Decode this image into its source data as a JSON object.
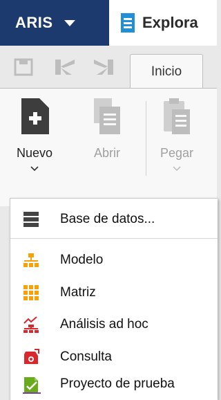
{
  "window": {
    "app_button_label": "ARIS",
    "tab_title": "Explora"
  },
  "quick_access": {
    "icons": [
      "save-icon",
      "undo-icon",
      "redo-icon"
    ]
  },
  "ribbon": {
    "tabs": [
      {
        "label": "Inicio",
        "active": true
      }
    ],
    "buttons": [
      {
        "label": "Nuevo",
        "enabled": true,
        "has_dropdown": true
      },
      {
        "label": "Abrir",
        "enabled": false
      },
      {
        "label": "Pegar",
        "enabled": false,
        "has_dropdown": true
      }
    ]
  },
  "new_menu": {
    "items": [
      {
        "label": "Base de datos...",
        "icon": "database-icon"
      },
      {
        "label": "Modelo",
        "icon": "model-icon"
      },
      {
        "label": "Matriz",
        "icon": "matrix-icon"
      },
      {
        "label": "Análisis ad hoc",
        "icon": "ad-hoc-analysis-icon"
      },
      {
        "label": "Consulta",
        "icon": "query-icon"
      },
      {
        "label": "Proyecto de prueba",
        "icon": "test-project-icon"
      }
    ]
  },
  "colors": {
    "app_button_bg": "#1c3a6e",
    "ribbon_bg": "#f8f8f8",
    "disabled_text": "#a0a0a0",
    "orange_accent": "#f5a20a",
    "red_accent": "#d8272d",
    "green_accent": "#6aaa1d"
  }
}
